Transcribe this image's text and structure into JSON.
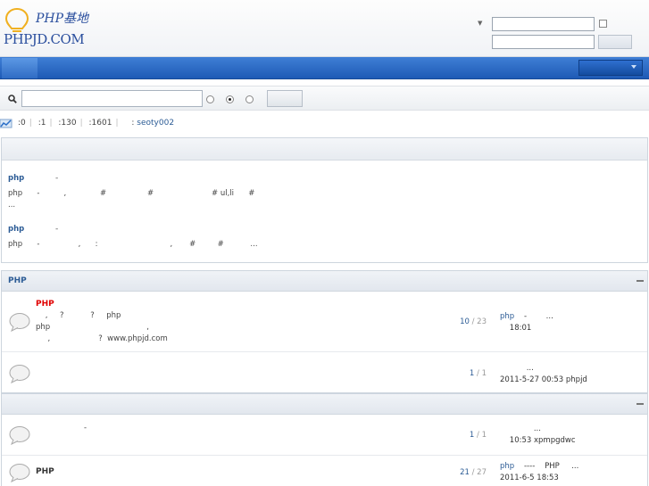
{
  "header": {
    "logo_cn": "PHP基地",
    "logo_en": "PHPJD.COM"
  },
  "stats": {
    "items": [
      ":0",
      ":1",
      ":130",
      ":1601"
    ],
    "newest_member": "seoty002"
  },
  "announcements": [
    {
      "title": "php",
      "dash": "-",
      "lines": [
        "php      -          ,              #                 #                        # ul,li      #",
        "..."
      ]
    },
    {
      "title": "php",
      "dash": "-",
      "lines": [
        "php      -                ,      :                              ,       #         #           ..."
      ]
    }
  ],
  "categories": [
    {
      "title": "PHP",
      "forums": [
        {
          "name": "PHP",
          "name_color": "#e00000",
          "desc": "    ,     ?           ?     php\nphp                                        ,\n     ,                    ?  www.phpjd.com",
          "threads": "10",
          "posts": "23",
          "last_link": "php",
          "last_rest": "    -        ...",
          "last_time": "    18:01"
        },
        {
          "name": "",
          "name_color": "#333333",
          "desc": "",
          "threads": "1",
          "posts": "1",
          "last_link": "",
          "last_rest": "           ...",
          "last_time": "2011-5-27 00:53 phpjd"
        }
      ]
    },
    {
      "title": "",
      "forums": [
        {
          "name": "",
          "name_color": "#333333",
          "desc": "                    -",
          "threads": "1",
          "posts": "1",
          "last_link": "",
          "last_rest": "              ...",
          "last_time": "    10:53 xpmpgdwc"
        },
        {
          "name": "PHP",
          "name_color": "#333333",
          "desc": "",
          "threads": "21",
          "posts": "27",
          "last_link": "php",
          "last_rest": "    ----    PHP     ...",
          "last_time": "2011-6-5 18:53"
        }
      ]
    }
  ]
}
